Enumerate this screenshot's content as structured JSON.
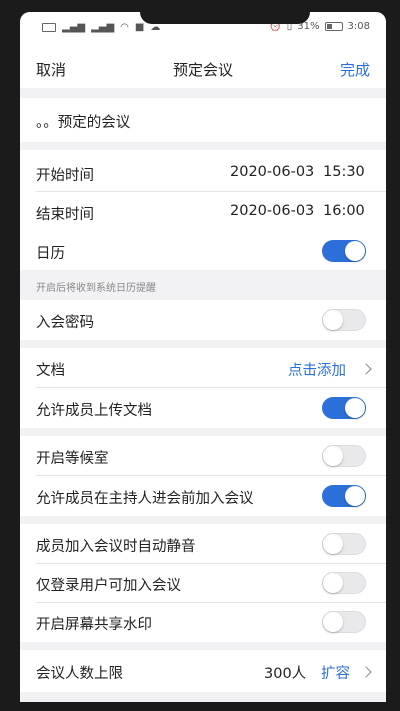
{
  "status_bar": {
    "battery_percent": "31%",
    "time": "3:08"
  },
  "nav": {
    "cancel_label": "取消",
    "title": "预定会议",
    "done_label": "完成"
  },
  "topic": {
    "value": "。。预定的会议"
  },
  "time": {
    "start_label": "开始时间",
    "start_date": "2020-06-03",
    "start_time": "15:30",
    "end_label": "结束时间",
    "end_date": "2020-06-03",
    "end_time": "16:00"
  },
  "calendar": {
    "label": "日历",
    "enabled": true,
    "hint": "开启后将收到系统日历提醒"
  },
  "password": {
    "label": "入会密码",
    "enabled": false
  },
  "documents": {
    "label": "文档",
    "action_label": "点击添加",
    "allow_upload_label": "允许成员上传文档",
    "allow_upload_enabled": true
  },
  "waiting_room": {
    "label": "开启等候室",
    "enabled": false,
    "join_before_host_label": "允许成员在主持人进会前加入会议",
    "join_before_host_enabled": true
  },
  "options": {
    "auto_mute_label": "成员加入会议时自动静音",
    "auto_mute_enabled": false,
    "logged_in_only_label": "仅登录用户可加入会议",
    "logged_in_only_enabled": false,
    "watermark_label": "开启屏幕共享水印",
    "watermark_enabled": false
  },
  "capacity": {
    "label": "会议人数上限",
    "value": "300人",
    "action_label": "扩容"
  },
  "colors": {
    "accent": "#2d6fd9",
    "background": "#f2f2f4"
  }
}
